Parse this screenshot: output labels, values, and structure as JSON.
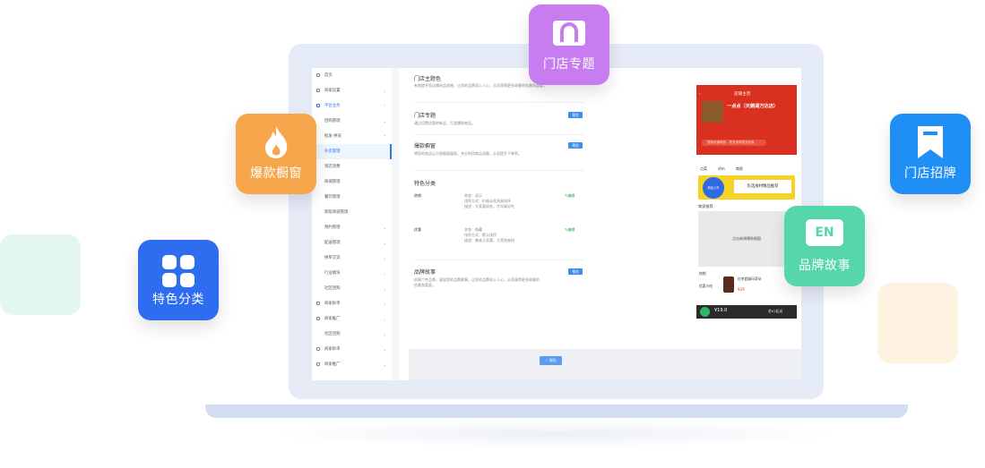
{
  "badges": {
    "store_topic": "门店专题",
    "hot_window": "爆款橱窗",
    "store_sign": "门店招牌",
    "feature_cat": "特色分类",
    "brand_story": "品牌故事",
    "en_label": "EN"
  },
  "colors": {
    "purple": "#c77cf0",
    "orange": "#f7a54a",
    "blue": "#1f8ff6",
    "navy": "#2f6df0",
    "green": "#55d6ab",
    "accent": "#2f7ae0"
  },
  "sidebar": {
    "items": [
      {
        "label": "首页",
        "chev": ""
      },
      {
        "label": "商家设置",
        "chev": "⌄"
      },
      {
        "label": "平台业务",
        "chev": "⌃"
      },
      {
        "label": "团购管理",
        "chev": "⌄"
      },
      {
        "label": "批发·供货",
        "chev": "⌃"
      },
      {
        "label": "外卖管理",
        "chev": ""
      },
      {
        "label": "到店消费",
        "chev": ""
      },
      {
        "label": "商城管理",
        "chev": ""
      },
      {
        "label": "餐饮管理",
        "chev": ""
      },
      {
        "label": "新版商城管理",
        "chev": ""
      },
      {
        "label": "预约管理",
        "chev": "⌄"
      },
      {
        "label": "配送管理",
        "chev": "⌄"
      },
      {
        "label": "拼单交流",
        "chev": "⌄"
      },
      {
        "label": "行业模块",
        "chev": "⌄"
      },
      {
        "label": "社区团购",
        "chev": "⌄"
      },
      {
        "label": "商家拆单",
        "chev": "⌄"
      },
      {
        "label": "商家推广",
        "chev": "⌄"
      },
      {
        "label": "社区团购",
        "chev": "⌄"
      },
      {
        "label": "商家拆单",
        "chev": "⌄"
      },
      {
        "label": "商家推广",
        "chev": "⌄"
      }
    ]
  },
  "content": {
    "theme_title": "门店主题色",
    "theme_desc": "有效提升您店铺的品质感，让您的品牌深入人心，从而获得更多顾客的信赖和喜爱。",
    "topic_title": "门店专题",
    "topic_desc": "通过设置优惠的新品、打造爆款商品。",
    "window_title": "爆款橱窗",
    "window_desc": "将您的商品以大图橱窗展现，充分利用商品流量，从而提升下单率。",
    "cat_title": "特色分类",
    "hot_label": "热销",
    "hot_status": "状态：显示",
    "hot_sort": "排序方式：价格从低到高排序",
    "hot_desc": "描述：大家喜欢吃，才叫真好吃",
    "promo_label": "优惠",
    "promo_status": "状态：隐藏",
    "promo_sort": "排序方式：默认排序",
    "promo_desc": "描述：美味又实惠，大家快来抢",
    "edit_label": "编辑",
    "story_title": "品牌故事",
    "story_desc": "创建个性品牌，展现您的品牌故事，让您的品牌深入人心，从而获得更多顾客的信赖和喜爱。",
    "tag_label": "预览",
    "save_label": "保存"
  },
  "phone": {
    "title": "店铺主页",
    "shop_name": "一点点（天鹅湖万达店）",
    "search_placeholder": "搜索店铺商品，更多选择更多优惠",
    "tabs": [
      "点菜",
      "评价",
      "商家"
    ],
    "banner_text": "优选食材精品推荐",
    "banner_badge": "新品上市",
    "rec_title": "商家推荐",
    "rec_box": "点击新增爆款橱窗",
    "hot": "热销",
    "promo": "优惠小吃",
    "item_name": "红茶超级玛奇朵",
    "item_price": "¥29",
    "cart_price": "¥19.0",
    "cart_btn": "差¥1起送"
  }
}
